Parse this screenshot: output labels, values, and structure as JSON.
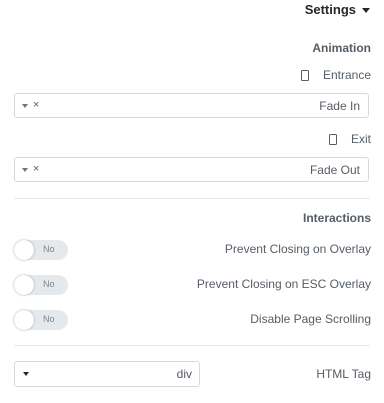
{
  "header": {
    "title": "Settings"
  },
  "animation": {
    "section_title": "Animation",
    "entrance": {
      "label": "Entrance",
      "value": "Fade In"
    },
    "exit": {
      "label": "Exit",
      "value": "Fade Out"
    },
    "clear_glyph": "×"
  },
  "interactions": {
    "section_title": "Interactions",
    "toggles": [
      {
        "label": "Prevent Closing on Overlay",
        "state": "No"
      },
      {
        "label": "Prevent Closing on ESC Overlay",
        "state": "No"
      },
      {
        "label": "Disable Page Scrolling",
        "state": "No"
      }
    ]
  },
  "html_tag": {
    "label": "HTML Tag",
    "value": "div"
  }
}
